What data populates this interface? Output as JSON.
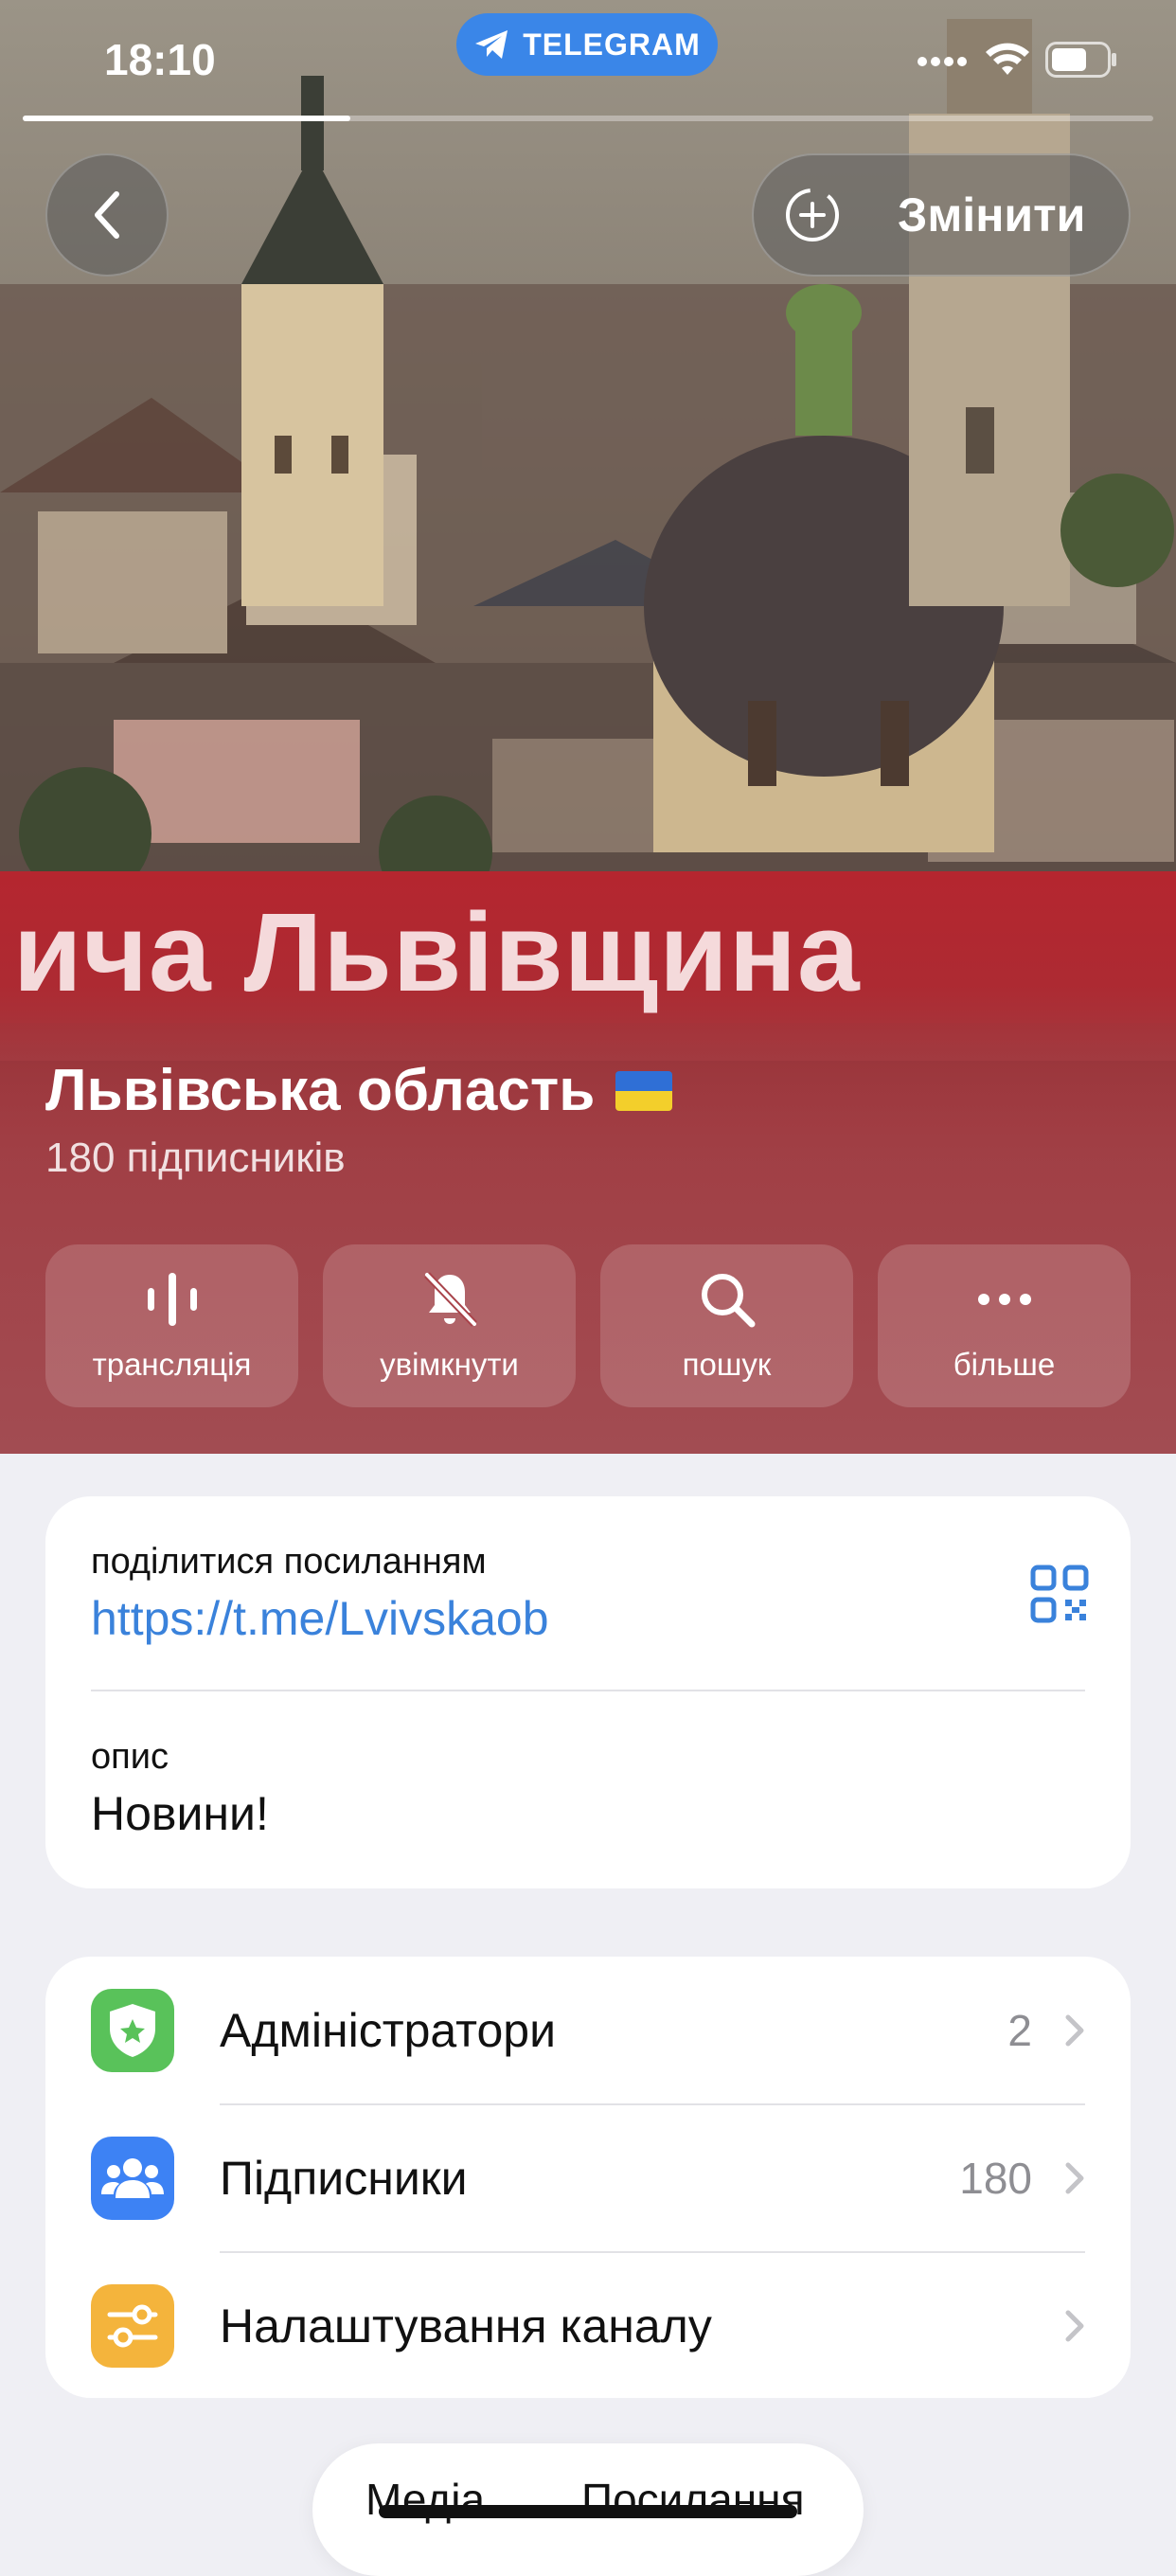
{
  "status_bar": {
    "time": "18:10",
    "app_pill": "TELEGRAM",
    "story_progress": 0.29
  },
  "header": {
    "back_icon": "chevron-left-icon",
    "edit_label": "Змінити",
    "edit_icon": "add-circle-icon"
  },
  "banner": {
    "text": "ича Львівщина"
  },
  "channel": {
    "title": "Львівська область",
    "subscribers_text": "180 підписників"
  },
  "actions": [
    {
      "label": "трансляція",
      "icon": "live-stream-icon"
    },
    {
      "label": "увімкнути",
      "icon": "bell-off-icon"
    },
    {
      "label": "пошук",
      "icon": "search-icon"
    },
    {
      "label": "більше",
      "icon": "more-icon"
    }
  ],
  "info": {
    "share_label": "поділитися посиланням",
    "link": "https://t.me/Lvivskaob",
    "desc_label": "опис",
    "desc_text": "Новини!"
  },
  "settings_list": [
    {
      "label": "Адміністратори",
      "value": "2",
      "icon": "shield-star-icon",
      "color": "#59c25a"
    },
    {
      "label": "Підписники",
      "value": "180",
      "icon": "people-icon",
      "color": "#3d82f4"
    },
    {
      "label": "Налаштування каналу",
      "value": "",
      "icon": "sliders-icon",
      "color": "#f4b43c"
    }
  ],
  "bottom_tabs": {
    "media": "Медіа",
    "links": "Посилання"
  },
  "colors": {
    "link": "#3a82db",
    "telegram": "#3a86e8",
    "banner_red": "#b5262f"
  }
}
